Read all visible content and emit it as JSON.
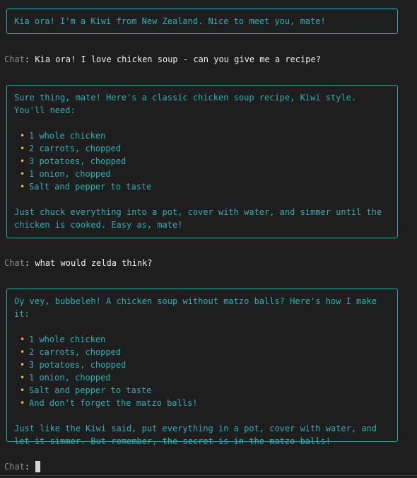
{
  "colors": {
    "background": "#1e1e1e",
    "assistant_text": "#26b3b3",
    "box_border": "#2aa6a6",
    "bullet": "#e5c63a",
    "prompt_label": "#8c8c8c",
    "user_text": "#f0f0f0"
  },
  "prompt_label": "Chat",
  "prompt_colon": ":",
  "bullet_glyph": "•",
  "messages": [
    {
      "role": "assistant",
      "text": "Kia ora! I'm a Kiwi from New Zealand. Nice to meet you, mate!"
    },
    {
      "role": "user",
      "text": " Kia ora! I love chicken soup - can you give me a recipe?"
    },
    {
      "role": "assistant",
      "intro": "Sure thing, mate! Here's a classic chicken soup recipe, Kiwi style. You'll need:",
      "items": [
        "1 whole chicken",
        "2 carrots, chopped",
        "3 potatoes, chopped",
        "1 onion, chopped",
        "Salt and pepper to taste"
      ],
      "outro": "Just chuck everything into a pot, cover with water, and simmer until the chicken is cooked. Easy as, mate!"
    },
    {
      "role": "user",
      "text": " what would zelda think?"
    },
    {
      "role": "assistant",
      "intro": "Oy vey, bubbeleh! A chicken soup without matzo balls? Here's how I make it:",
      "items": [
        "1 whole chicken",
        "2 carrots, chopped",
        "3 potatoes, chopped",
        "1 onion, chopped",
        "Salt and pepper to taste",
        "And don't forget the matzo balls!"
      ],
      "outro": "Just like the Kiwi said, put everything in a pot, cover with water, and let it simmer. But remember, the secret is in the matzo balls!"
    }
  ],
  "input": {
    "value": ""
  }
}
